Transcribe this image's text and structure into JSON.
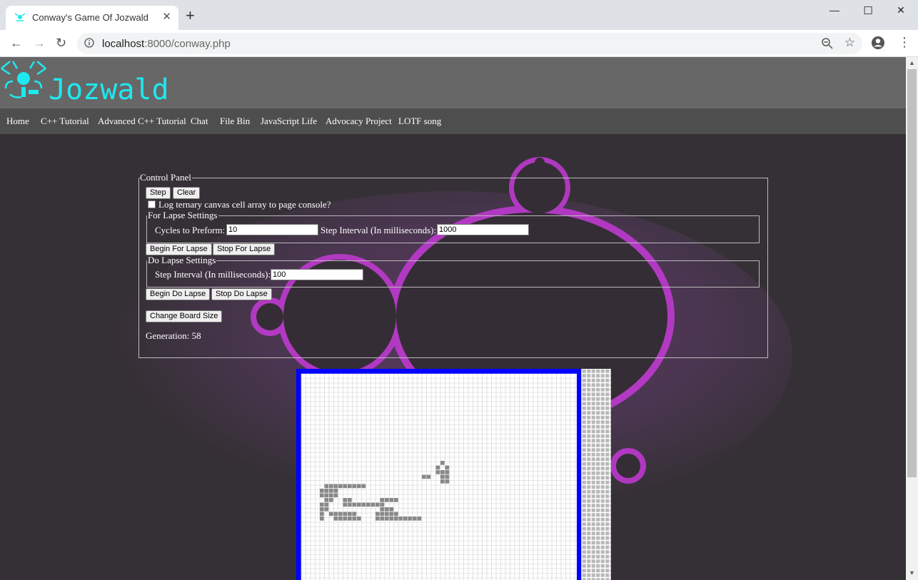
{
  "browser": {
    "tab_title": "Conway's Game Of Jozwald",
    "close_tab": "✕",
    "new_tab": "+",
    "url_host": "localhost",
    "url_rest": ":8000/conway.php",
    "window_minimize": "—",
    "window_maximize": "☐",
    "window_close": "✕"
  },
  "site": {
    "title": "Jozwald",
    "accent_color": "#1de9f0",
    "nav": [
      "Home",
      "C++ Tutorial",
      "Advanced C++ Tutorial",
      "Chat",
      "File Bin",
      "JavaScript Life",
      "Advocacy Project",
      "LOTF song"
    ]
  },
  "control_panel": {
    "legend": "Control Panel",
    "step_label": "Step",
    "clear_label": "Clear",
    "log_checkbox_label": "Log ternary canvas cell array to page console?",
    "log_checked": false,
    "for_lapse": {
      "legend": "For Lapse Settings",
      "cycles_label": "Cycles to Preform:",
      "cycles_value": "10",
      "interval_label": "Step Interval (In milliseconds):",
      "interval_value": "1000",
      "begin_label": "Begin For Lapse",
      "stop_label": "Stop For Lapse"
    },
    "do_lapse": {
      "legend": "Do Lapse Settings",
      "interval_label": "Step Interval (In milliseconds):",
      "interval_value": "100",
      "begin_label": "Begin Do Lapse",
      "stop_label": "Stop Do Lapse"
    },
    "change_board_label": "Change Board Size",
    "generation_label": "Generation:",
    "generation_value": "58"
  },
  "board": {
    "border_color": "#0000ff",
    "live_color": "#888888",
    "live_cells": [
      [
        26,
        4
      ],
      [
        25,
        5
      ],
      [
        27,
        5
      ],
      [
        25,
        6
      ],
      [
        26,
        6
      ],
      [
        27,
        6
      ],
      [
        22,
        7
      ],
      [
        23,
        7
      ],
      [
        26,
        7
      ],
      [
        27,
        7
      ],
      [
        26,
        8
      ],
      [
        27,
        8
      ],
      [
        1,
        9
      ],
      [
        2,
        9
      ],
      [
        3,
        9
      ],
      [
        4,
        9
      ],
      [
        5,
        9
      ],
      [
        6,
        9
      ],
      [
        7,
        9
      ],
      [
        8,
        9
      ],
      [
        9,
        9
      ],
      [
        0,
        10
      ],
      [
        1,
        10
      ],
      [
        2,
        10
      ],
      [
        3,
        10
      ],
      [
        0,
        11
      ],
      [
        1,
        11
      ],
      [
        2,
        11
      ],
      [
        3,
        11
      ],
      [
        1,
        12
      ],
      [
        2,
        12
      ],
      [
        5,
        12
      ],
      [
        6,
        12
      ],
      [
        13,
        12
      ],
      [
        14,
        12
      ],
      [
        15,
        12
      ],
      [
        16,
        12
      ],
      [
        0,
        13
      ],
      [
        1,
        13
      ],
      [
        5,
        13
      ],
      [
        6,
        13
      ],
      [
        7,
        13
      ],
      [
        8,
        13
      ],
      [
        9,
        13
      ],
      [
        10,
        13
      ],
      [
        11,
        13
      ],
      [
        12,
        13
      ],
      [
        13,
        13
      ],
      [
        0,
        14
      ],
      [
        1,
        14
      ],
      [
        13,
        14
      ],
      [
        14,
        14
      ],
      [
        15,
        14
      ],
      [
        0,
        15
      ],
      [
        2,
        15
      ],
      [
        3,
        15
      ],
      [
        4,
        15
      ],
      [
        5,
        15
      ],
      [
        6,
        15
      ],
      [
        7,
        15
      ],
      [
        12,
        15
      ],
      [
        13,
        15
      ],
      [
        14,
        15
      ],
      [
        15,
        15
      ],
      [
        16,
        15
      ],
      [
        0,
        16
      ],
      [
        3,
        16
      ],
      [
        4,
        16
      ],
      [
        5,
        16
      ],
      [
        6,
        16
      ],
      [
        7,
        16
      ],
      [
        8,
        16
      ],
      [
        12,
        16
      ],
      [
        13,
        16
      ],
      [
        14,
        16
      ],
      [
        15,
        16
      ],
      [
        16,
        16
      ],
      [
        17,
        16
      ],
      [
        18,
        16
      ],
      [
        19,
        16
      ],
      [
        20,
        16
      ],
      [
        21,
        16
      ]
    ]
  }
}
